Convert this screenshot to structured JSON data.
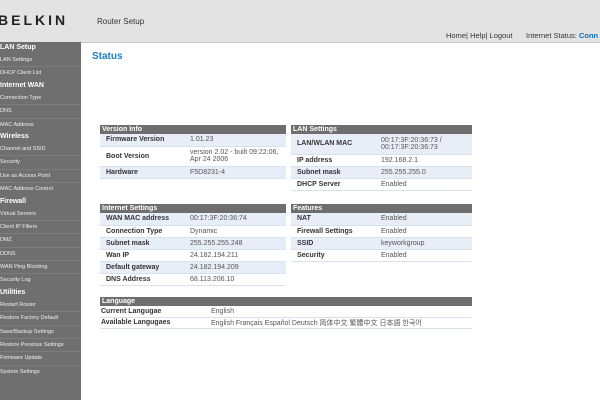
{
  "header": {
    "logo": "BELKIN",
    "app_title": "Router Setup",
    "links": [
      "Home",
      "Help",
      "Logout"
    ],
    "internet_status_label": "Internet Status:",
    "internet_status_value": "Conn"
  },
  "sidebar": {
    "sections": [
      {
        "title": "LAN Setup",
        "items": [
          "LAN Settings",
          "DHCP Client List"
        ]
      },
      {
        "title": "Internet WAN",
        "items": [
          "Connection Type",
          "DNS",
          "MAC Address"
        ]
      },
      {
        "title": "Wireless",
        "items": [
          "Channel and SSID",
          "Security",
          "Use as Access Point",
          "MAC Address Control"
        ]
      },
      {
        "title": "Firewall",
        "items": [
          "Virtual Servers",
          "Client IP Filters",
          "DMZ",
          "DDNS",
          "WAN Ping Blocking",
          "Security Log"
        ]
      },
      {
        "title": "Utilities",
        "items": [
          "Restart Router",
          "Restore Factory Default",
          "Save/Backup Settings",
          "Restore Previous Settings",
          "Firmware Update",
          "System Settings"
        ]
      }
    ]
  },
  "page_title": "Status",
  "version_info": {
    "title": "Version Info",
    "rows": [
      {
        "label": "Firmware Version",
        "value": "1.01.23"
      },
      {
        "label": "Boot Version",
        "value": "version 2.02 - built 09:22:06, Apr 24 2006"
      },
      {
        "label": "Hardware",
        "value": "F5D8231-4"
      }
    ]
  },
  "lan_settings": {
    "title": "LAN Settings",
    "rows": [
      {
        "label": "LAN/WLAN MAC",
        "value": "00:17:3F:20:36:73 / 00:17:3F:20:36:73"
      },
      {
        "label": "IP address",
        "value": "192.168.2.1"
      },
      {
        "label": "Subnet mask",
        "value": "255.255.255.0"
      },
      {
        "label": "DHCP Server",
        "value": "Enabled"
      }
    ]
  },
  "internet_settings": {
    "title": "Internet Settings",
    "rows": [
      {
        "label": "WAN MAC address",
        "value": "00:17:3F:20:36:74"
      },
      {
        "label": "Connection Type",
        "value": "Dynamic"
      },
      {
        "label": "Subnet mask",
        "value": "255.255.255.248"
      },
      {
        "label": "Wan IP",
        "value": "24.182.194.211"
      },
      {
        "label": "Default gateway",
        "value": "24.182.194.209"
      },
      {
        "label": "DNS Address",
        "value": "68.113.206.10"
      }
    ]
  },
  "features": {
    "title": "Features",
    "rows": [
      {
        "label": "NAT",
        "value": "Enabled"
      },
      {
        "label": "Firewall Settings",
        "value": "Enabled"
      },
      {
        "label": "SSID",
        "value": "keyworkgroup"
      },
      {
        "label": "Security",
        "value": "Enabled"
      }
    ]
  },
  "language": {
    "title": "Language",
    "rows": [
      {
        "label": "Current Langugae",
        "value": "English"
      },
      {
        "label": "Available Langugaes",
        "value": "English Français Español Deutsch 简体中文 繁體中文 日本語 한국어"
      }
    ]
  },
  "colors": {
    "header_bg": "#e3e3e3",
    "sidebar_bg": "#6f6f6f",
    "panel_header_bg": "#6e6e6e",
    "row_shade": "#e7eef8",
    "title_blue": "#1a7fc4"
  }
}
